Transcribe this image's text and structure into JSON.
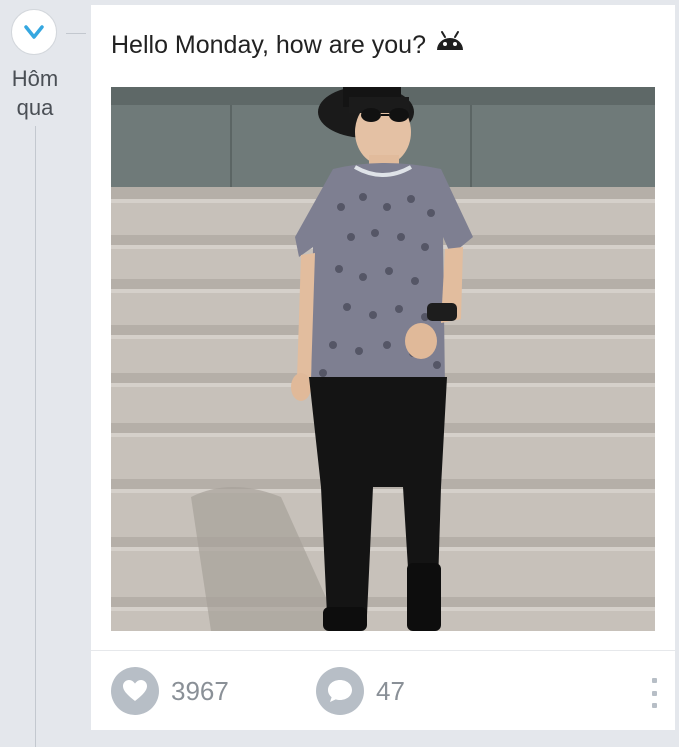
{
  "timeline": {
    "time_label_line1": "Hôm",
    "time_label_line2": "qua",
    "icon": "clock-check-icon"
  },
  "post": {
    "text": "Hello Monday, how are you?",
    "emoticon": "android-icon",
    "photo": "person-on-stairs-photo",
    "likes": "3967",
    "comments": "47"
  },
  "colors": {
    "accent": "#35a7e0",
    "action_icon_bg": "#b7bec6",
    "count_text": "#8a9097",
    "page_bg": "#e4e7ec"
  }
}
